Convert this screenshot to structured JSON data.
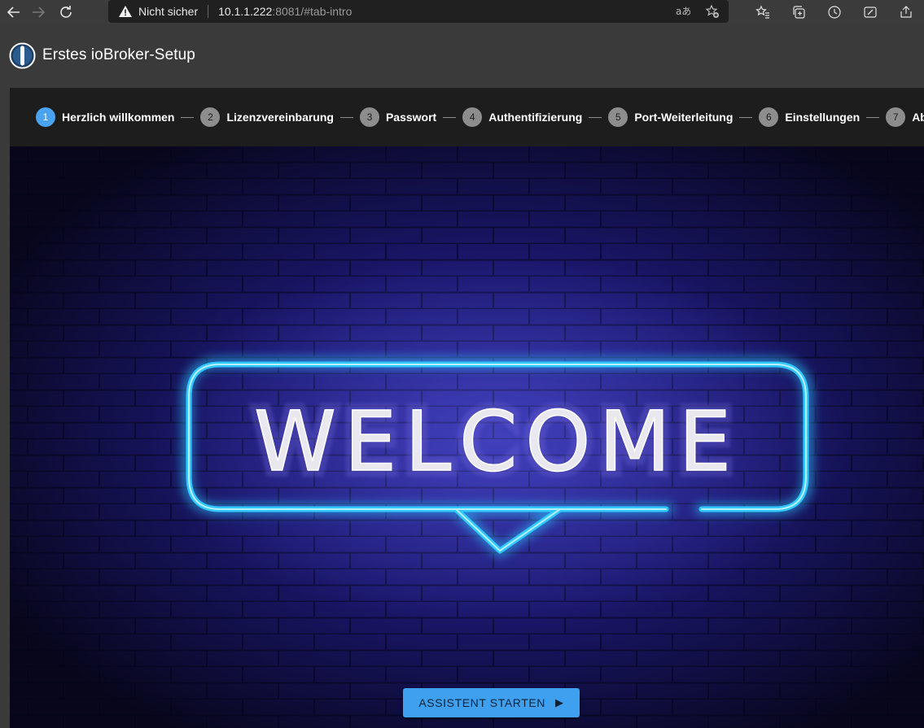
{
  "browser": {
    "insecure_label": "Nicht sicher",
    "url_host": "10.1.1.222",
    "url_rest": ":8081/#tab-intro",
    "icons": [
      "back-icon",
      "forward-icon",
      "reload-icon",
      "warning-icon",
      "read-aloud-icon",
      "add-favorite-icon",
      "favorites-icon",
      "collections-icon",
      "history-icon",
      "screenshot-icon",
      "share-icon"
    ]
  },
  "app": {
    "title": "Erstes ioBroker-Setup"
  },
  "stepper": {
    "steps": [
      {
        "number": "1",
        "label": "Herzlich willkommen",
        "active": true
      },
      {
        "number": "2",
        "label": "Lizenzvereinbarung",
        "active": false
      },
      {
        "number": "3",
        "label": "Passwort",
        "active": false
      },
      {
        "number": "4",
        "label": "Authentifizierung",
        "active": false
      },
      {
        "number": "5",
        "label": "Port-Weiterleitung",
        "active": false
      },
      {
        "number": "6",
        "label": "Einstellungen",
        "active": false
      },
      {
        "number": "7",
        "label": "Abschlie",
        "active": false
      }
    ]
  },
  "hero": {
    "neon_text": "WELCOME"
  },
  "start": {
    "label": "ASSISTENT STARTEN"
  },
  "colors": {
    "accent": "#3fa0ef",
    "neon": "#29c6ff",
    "wall": "#13124a"
  }
}
